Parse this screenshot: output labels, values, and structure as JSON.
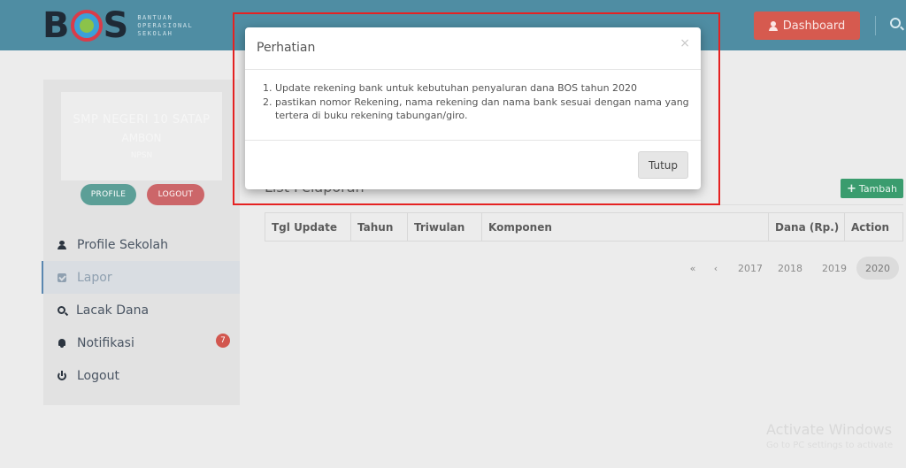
{
  "header": {
    "logo_b": "B",
    "logo_s": "S",
    "logo_lines": [
      "BANTUAN",
      "OPERASIONAL",
      "SEKOLAH"
    ],
    "dashboard_label": "Dashboard"
  },
  "profile": {
    "name_line1": "SMP NEGERI 10 SATAP",
    "name_line2": "AMBON",
    "name_line3": "NPSN",
    "profile_btn": "PROFILE",
    "logout_btn": "LOGOUT"
  },
  "sidebar": {
    "items": [
      {
        "label": "Profile Sekolah",
        "icon": "user-icon"
      },
      {
        "label": "Lapor",
        "icon": "check-square-icon"
      },
      {
        "label": "Lacak Dana",
        "icon": "search-icon"
      },
      {
        "label": "Notifikasi",
        "icon": "bell-icon",
        "badge": "7"
      },
      {
        "label": "Logout",
        "icon": "power-icon"
      }
    ]
  },
  "main": {
    "list_title": "List Pelaporan",
    "tambah_label": "Tambah",
    "columns": [
      "Tgl Update",
      "Tahun",
      "Triwulan",
      "Komponen",
      "Dana (Rp.)",
      "Action"
    ],
    "pager": {
      "first": "«",
      "prev": "‹",
      "years": [
        "2017",
        "2018",
        "2019",
        "2020"
      ],
      "active": "2020"
    }
  },
  "modal": {
    "title": "Perhatian",
    "close": "×",
    "items": [
      "Update rekening bank untuk kebutuhan penyaluran dana BOS tahun 2020",
      "pastikan nomor Rekening, nama rekening dan nama bank sesuai dengan nama yang tertera di buku rekening tabungan/giro."
    ],
    "button": "Tutup"
  },
  "watermark": {
    "line1": "Activate Windows",
    "line2": "Go to PC settings to activate"
  },
  "colors": {
    "topbar": "#4f8da3",
    "dashboard": "#d65a4f",
    "tambah": "#3a9c6e",
    "highlight_frame": "#e52222"
  }
}
